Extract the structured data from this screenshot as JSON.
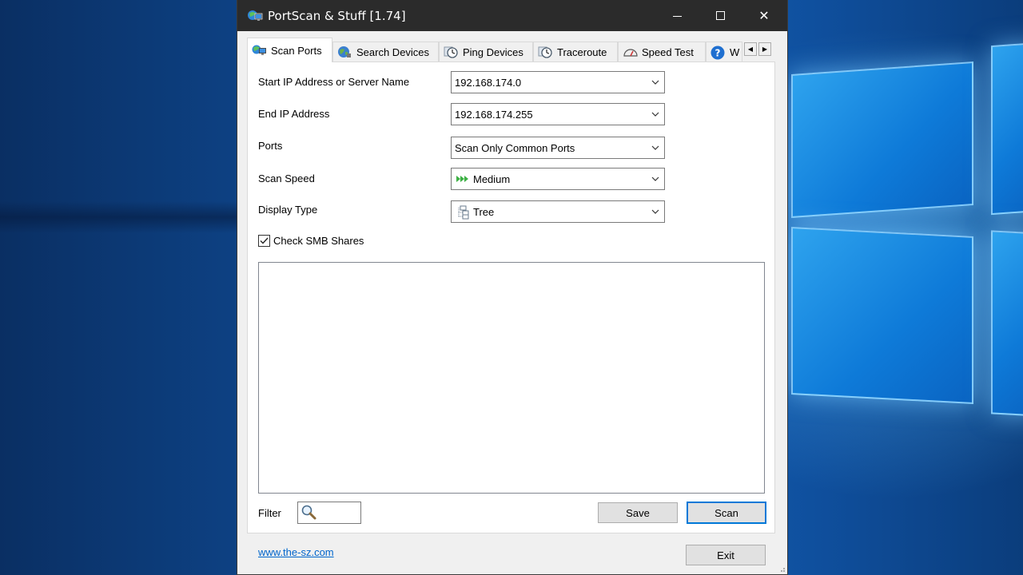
{
  "window": {
    "title": "PortScan & Stuff [1.74]",
    "minimize_icon": "minimize-icon",
    "maximize_icon": "maximize-icon",
    "close_icon": "close-icon",
    "close_glyph": "✕"
  },
  "tabs": [
    {
      "label": "Scan Ports",
      "icon": "network-scan-icon",
      "active": true
    },
    {
      "label": "Search Devices",
      "icon": "globe-icon",
      "active": false
    },
    {
      "label": "Ping Devices",
      "icon": "stopwatch-icon",
      "active": false
    },
    {
      "label": "Traceroute",
      "icon": "stopwatch-icon",
      "active": false
    },
    {
      "label": "Speed Test",
      "icon": "speedometer-icon",
      "active": false
    },
    {
      "label": "W",
      "icon": "help-icon",
      "active": false
    }
  ],
  "tab_scroll": {
    "left": "◀",
    "right": "▶"
  },
  "form": {
    "start_ip_label": "Start IP Address or Server Name",
    "start_ip_value": "192.168.174.0",
    "end_ip_label": "End IP Address",
    "end_ip_value": "192.168.174.255",
    "ports_label": "Ports",
    "ports_value": "Scan Only Common Ports",
    "speed_label": "Scan Speed",
    "speed_value": "Medium",
    "display_label": "Display Type",
    "display_value": "Tree",
    "smb_label": "Check SMB Shares",
    "smb_checked": true
  },
  "bottom": {
    "filter_label": "Filter",
    "save_label": "Save",
    "scan_label": "Scan",
    "exit_label": "Exit",
    "website": "www.the-sz.com"
  },
  "colors": {
    "titlebar": "#2b2b2b",
    "accent": "#0078d7",
    "link": "#0066cc"
  }
}
